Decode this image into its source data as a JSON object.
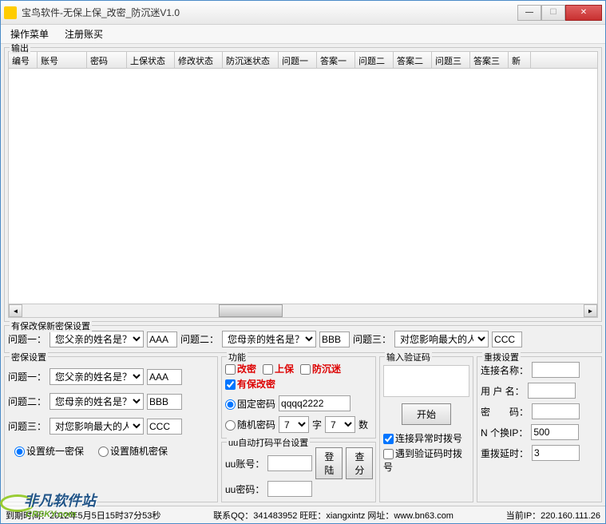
{
  "window": {
    "title": "宝鸟软件-无保上保_改密_防沉迷V1.0"
  },
  "menu": {
    "op": "操作菜单",
    "reg": "注册账买"
  },
  "output": {
    "legend": "输出",
    "cols": [
      "编号",
      "账号",
      "密码",
      "上保状态",
      "修改状态",
      "防沉迷状态",
      "问题一",
      "答案一",
      "问题二",
      "答案二",
      "问题三",
      "答案三",
      "新"
    ]
  },
  "newsec": {
    "legend": "有保改保新密保设置",
    "q1lbl": "问题一：",
    "q1sel": "您父亲的姓名是？",
    "q1ans": "AAA",
    "q2lbl": "问题二：",
    "q2sel": "您母亲的姓名是？",
    "q2ans": "BBB",
    "q3lbl": "问题三：",
    "q3sel": "对您影响最大的人！",
    "q3ans": "CCC"
  },
  "sec": {
    "legend": "密保设置",
    "q1lbl": "问题一：",
    "q1sel": "您父亲的姓名是？",
    "q1ans": "AAA",
    "q2lbl": "问题二：",
    "q2sel": "您母亲的姓名是？",
    "q2ans": "BBB",
    "q3lbl": "问题三：",
    "q3sel": "对您影响最大的人！",
    "q3ans": "CCC",
    "r1": "设置统一密保",
    "r2": "设置随机密保"
  },
  "func": {
    "legend": "功能",
    "c1": "改密",
    "c2": "上保",
    "c3": "防沉迷",
    "c4": "有保改密",
    "rfix": "固定密码",
    "fixval": "qqqq2222",
    "rrnd": "随机密码",
    "rsel1": "7",
    "rzi": "字",
    "rsel2": "7",
    "rshu": "数",
    "uulegend": "uu自动打码平台设置",
    "uuacclbl": "uu账号：",
    "uupwdlbl": "uu密码：",
    "btnlogin": "登陆",
    "btnquery": "查分"
  },
  "verify": {
    "legend": "输入验证码",
    "start": "开始",
    "c1": "连接异常时拨号",
    "c2": "遇到验证码时拨号"
  },
  "redial": {
    "legend": "重拨设置",
    "name": "连接名称：",
    "user": "用 户 名：",
    "pwd": "密　　码：",
    "nip": "N 个换IP：",
    "nipval": "500",
    "delay": "重拨延时：",
    "delayval": "3"
  },
  "status": {
    "expire": "到期时间：2012年5月5日15时37分53秒",
    "contact": "联系QQ：341483952  旺旺：xiangxintz 网址：www.bn63.com",
    "ip": "当前IP：220.160.111.26"
  },
  "wm": {
    "text": "非凡软件站",
    "sub": "CRSKY.com"
  }
}
